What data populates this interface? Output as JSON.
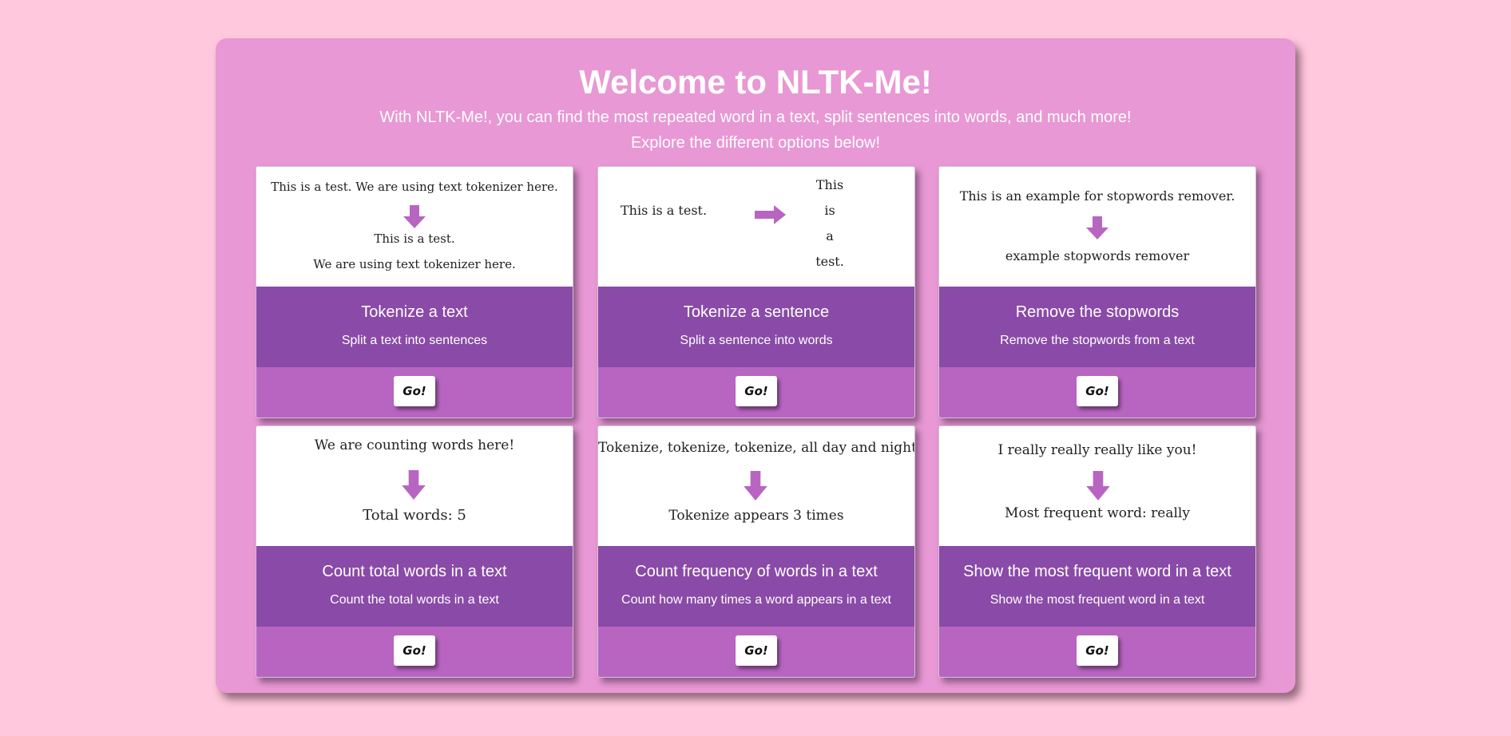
{
  "header": {
    "title": "Welcome to NLTK-Me!",
    "subtitle_line1": "With NLTK-Me!, you can find the most repeated word in a text, split sentences into words, and much more!",
    "subtitle_line2": "Explore the different options below!"
  },
  "colors": {
    "page_background": "#ffc8dc",
    "panel_background": "#e898d4",
    "card_info_background": "#8a4aa8",
    "card_action_background": "#b865c2",
    "arrow": "#b865c2"
  },
  "cards": [
    {
      "title": "Tokenize a text",
      "description": "Split a text into sentences",
      "button": "Go!",
      "demo": {
        "input": "This is a test. We are using text tokenizer here.",
        "output": [
          "This is a test.",
          "We are using text tokenizer here."
        ],
        "arrow_icon": "arrow-down-icon"
      }
    },
    {
      "title": "Tokenize a sentence",
      "description": "Split a sentence into words",
      "button": "Go!",
      "demo": {
        "input": "This is a test.",
        "output": [
          "This",
          "is",
          "a",
          "test."
        ],
        "arrow_icon": "arrow-right-icon"
      }
    },
    {
      "title": "Remove the stopwords",
      "description": "Remove the stopwords from a text",
      "button": "Go!",
      "demo": {
        "input": "This is an example for stopwords remover.",
        "output": [
          "example stopwords remover"
        ],
        "arrow_icon": "arrow-down-icon"
      }
    },
    {
      "title": "Count total words in a text",
      "description": "Count the total words in a text",
      "button": "Go!",
      "demo": {
        "input": "We are counting words here!",
        "output": [
          "Total words: 5"
        ],
        "arrow_icon": "arrow-down-icon"
      }
    },
    {
      "title": "Count frequency of words in a text",
      "description": "Count how many times a word appears in a text",
      "button": "Go!",
      "demo": {
        "input": "Tokenize, tokenize, tokenize, all day and night!",
        "output": [
          "Tokenize appears 3 times"
        ],
        "arrow_icon": "arrow-down-icon"
      }
    },
    {
      "title": "Show the most frequent word in a text",
      "description": "Show the most frequent word in a text",
      "button": "Go!",
      "demo": {
        "input": "I really really really like you!",
        "output": [
          "Most frequent word: really"
        ],
        "arrow_icon": "arrow-down-icon"
      }
    }
  ]
}
